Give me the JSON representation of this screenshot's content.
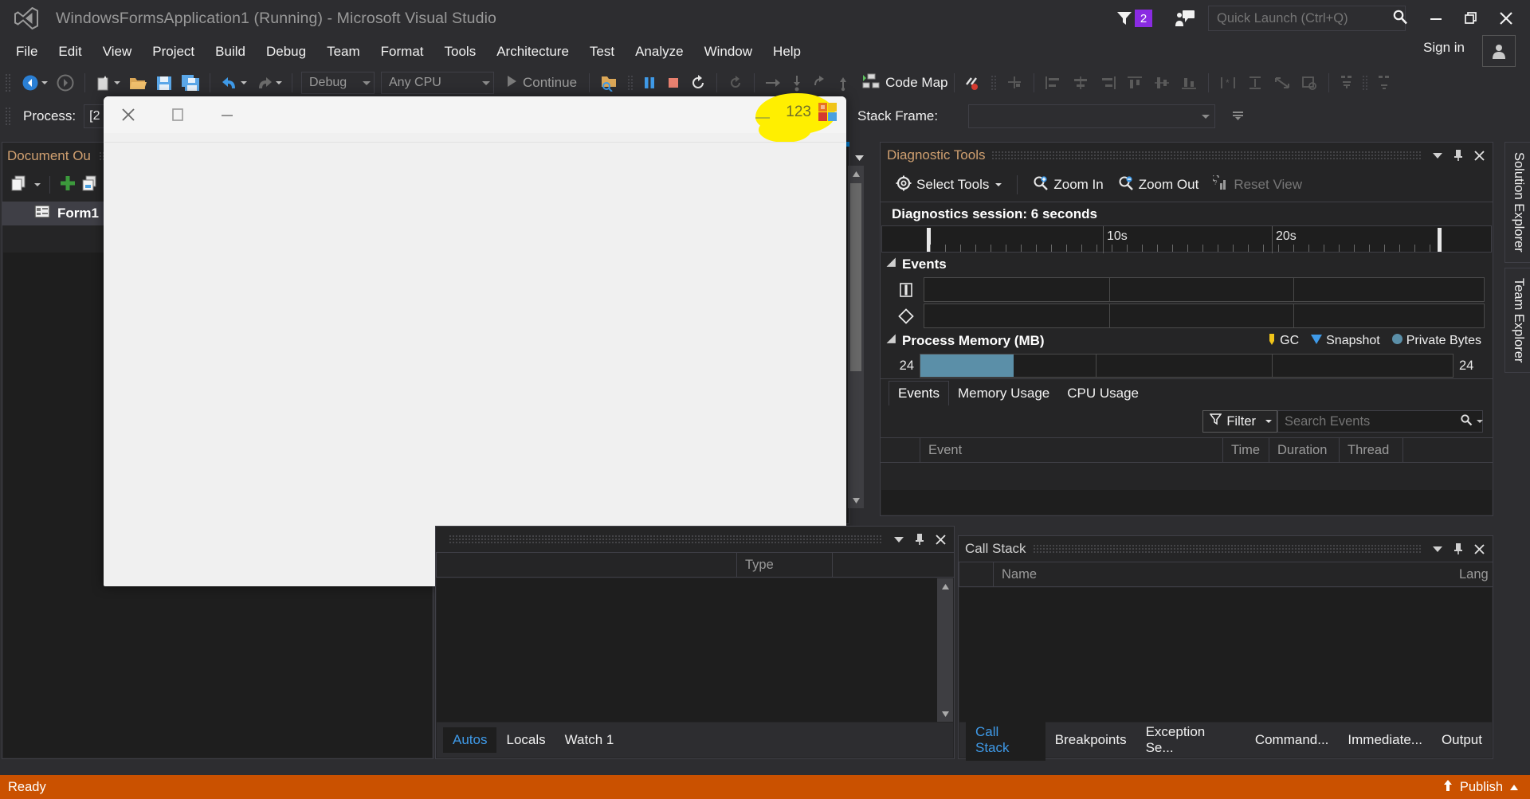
{
  "window": {
    "title": "WindowsFormsApplication1 (Running) - Microsoft Visual Studio",
    "logo_icon": "visual-studio-logo",
    "minimize_icon": "minimize-icon",
    "restore_icon": "restore-icon",
    "close_icon": "close-icon"
  },
  "titlebar": {
    "notifications_icon": "funnel-icon",
    "notifications_count": "2",
    "feedback_icon": "feedback-icon",
    "search_placeholder": "Quick Launch (Ctrl+Q)",
    "search_icon": "search-icon",
    "sign_in_label": "Sign in",
    "account_icon": "account-icon"
  },
  "menubar": {
    "items": [
      {
        "label": "File"
      },
      {
        "label": "Edit"
      },
      {
        "label": "View"
      },
      {
        "label": "Project"
      },
      {
        "label": "Build"
      },
      {
        "label": "Debug"
      },
      {
        "label": "Team"
      },
      {
        "label": "Format"
      },
      {
        "label": "Tools"
      },
      {
        "label": "Architecture"
      },
      {
        "label": "Test"
      },
      {
        "label": "Analyze"
      },
      {
        "label": "Window"
      },
      {
        "label": "Help"
      }
    ]
  },
  "toolbar": {
    "nav_back_icon": "navigate-back-icon",
    "nav_forward_icon": "navigate-forward-icon",
    "new_item_icon": "new-item-icon",
    "open_file_icon": "open-file-icon",
    "save_icon": "save-icon",
    "save_all_icon": "save-all-icon",
    "undo_icon": "undo-icon",
    "redo_icon": "redo-icon",
    "config_value": "Debug",
    "platform_value": "Any CPU",
    "continue_icon": "play-icon",
    "continue_label": "Continue",
    "attach_icon": "attach-to-process-icon",
    "break_all_icon": "pause-icon",
    "stop_icon": "stop-debugging-icon",
    "restart_icon": "restart-icon",
    "show_next_icon": "show-next-statement-icon",
    "step_over_icon": "step-over-icon",
    "step_into_icon": "step-into-icon",
    "step_out_icon": "step-out-icon",
    "code_map_icon": "code-map-icon",
    "code_map_label": "Code Map",
    "breakpoints_icon": "breakpoints-icon",
    "align_icon": "align-icon"
  },
  "processbar": {
    "process_label": "Process:",
    "process_value": "[2",
    "stack_frame_label": "Stack Frame:",
    "stack_frame_value": ""
  },
  "document_outline": {
    "title": "Document Ou",
    "copy_icon": "copy-icon",
    "add_icon": "add-icon",
    "duplicate_icon": "duplicate-icon",
    "nodes": [
      {
        "label": "Form1",
        "icon": "form-icon"
      }
    ]
  },
  "form_window": {
    "close_icon": "close-icon",
    "maximize_icon": "maximize-icon",
    "minimize_icon": "minimize-icon",
    "annotation_number": "123",
    "annotation_icon": "colorful-tiles-icon",
    "highlight_color": "#ffef00"
  },
  "autos_panel": {
    "title": "",
    "dropdown_icon": "chevron-down-icon",
    "pin_icon": "pin-icon",
    "close_icon": "close-icon",
    "columns": [
      "Type"
    ],
    "tabs": [
      {
        "label": "Autos",
        "active": true
      },
      {
        "label": "Locals",
        "active": false
      },
      {
        "label": "Watch 1",
        "active": false
      }
    ]
  },
  "diagnostic_tools": {
    "title": "Diagnostic Tools",
    "dropdown_icon": "chevron-down-icon",
    "pin_icon": "pin-icon",
    "close_icon": "close-icon",
    "select_tools_label": "Select Tools",
    "select_tools_icon": "gear-icon",
    "zoom_in_label": "Zoom In",
    "zoom_in_icon": "zoom-in-icon",
    "zoom_out_label": "Zoom Out",
    "zoom_out_icon": "zoom-out-icon",
    "reset_view_label": "Reset View",
    "reset_view_icon": "reset-view-icon",
    "session_label": "Diagnostics session: 6 seconds",
    "timeline_labels": [
      "10s",
      "20s"
    ],
    "events_section": "Events",
    "events_icon_break": "break-event-icon",
    "events_icon_diamond": "diamond-event-icon",
    "memory_section": "Process Memory (MB)",
    "legend": [
      {
        "label": "GC",
        "icon": "gc-marker-icon",
        "color": "#f0c419"
      },
      {
        "label": "Snapshot",
        "icon": "snapshot-marker-icon",
        "color": "#3f9ae8"
      },
      {
        "label": "Private Bytes",
        "icon": "private-bytes-icon",
        "color": "#5b8fa8"
      }
    ],
    "memory_axis_left": "24",
    "memory_axis_right": "24",
    "tabs": [
      {
        "label": "Events",
        "active": true
      },
      {
        "label": "Memory Usage",
        "active": false
      },
      {
        "label": "CPU Usage",
        "active": false
      }
    ],
    "filter_label": "Filter",
    "filter_icon": "filter-icon",
    "search_placeholder": "Search Events",
    "search_icon": "search-icon",
    "columns": [
      "Event",
      "Time",
      "Duration",
      "Thread"
    ]
  },
  "call_stack": {
    "title": "Call Stack",
    "dropdown_icon": "chevron-down-icon",
    "pin_icon": "pin-icon",
    "close_icon": "close-icon",
    "columns": [
      "Name",
      "Lang"
    ],
    "tabs": [
      {
        "label": "Call Stack",
        "active": true
      },
      {
        "label": "Breakpoints",
        "active": false
      },
      {
        "label": "Exception Se...",
        "active": false
      },
      {
        "label": "Command...",
        "active": false
      },
      {
        "label": "Immediate...",
        "active": false
      },
      {
        "label": "Output",
        "active": false
      }
    ]
  },
  "right_tabs": [
    {
      "label": "Solution Explorer"
    },
    {
      "label": "Team Explorer"
    }
  ],
  "statusbar": {
    "status": "Ready",
    "publish_label": "Publish",
    "publish_icon": "publish-up-arrow-icon",
    "publish_caret_icon": "caret-up-icon",
    "background_color": "#ca5100"
  },
  "chart_data": {
    "type": "area",
    "title": "Process Memory (MB)",
    "xlabel": "",
    "ylabel": "MB",
    "x_tick_labels": [
      "10s",
      "20s"
    ],
    "ylim": [
      0,
      24
    ],
    "series": [
      {
        "name": "Private Bytes",
        "color": "#5b8fa8",
        "values": [
          24,
          24,
          24,
          24,
          0,
          0,
          0,
          0,
          0,
          0,
          0,
          0
        ]
      }
    ],
    "grid": false,
    "legend_position": "top-right"
  }
}
